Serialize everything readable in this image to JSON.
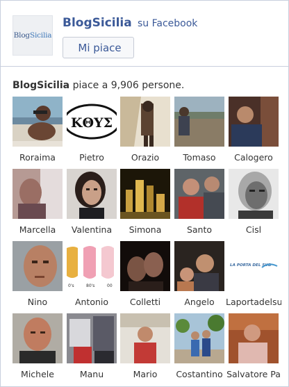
{
  "page": {
    "name": "BlogSicilia",
    "platform_suffix": "su Facebook",
    "logo_text_1": "Blog",
    "logo_text_2": "Sicilia"
  },
  "like_button": {
    "label": "Mi piace"
  },
  "count": {
    "name": "BlogSicilia",
    "text": "piace a 9,906 persone."
  },
  "fans": [
    {
      "name": "Roraima"
    },
    {
      "name": "Pietro"
    },
    {
      "name": "Orazio"
    },
    {
      "name": "Tomaso"
    },
    {
      "name": "Calogero"
    },
    {
      "name": "Marcella"
    },
    {
      "name": "Valentina"
    },
    {
      "name": "Simona"
    },
    {
      "name": "Santo"
    },
    {
      "name": "Cisl"
    },
    {
      "name": "Nino"
    },
    {
      "name": "Antonio"
    },
    {
      "name": "Colletti"
    },
    {
      "name": "Angelo"
    },
    {
      "name": "Laportadelsud"
    },
    {
      "name": "Michele"
    },
    {
      "name": "Manu"
    },
    {
      "name": "Mario"
    },
    {
      "name": "Costantino"
    },
    {
      "name": "Salvatore Pa"
    }
  ],
  "fan_photo_texts": {
    "pietro": "ΚΘΥΣ",
    "antonio_labels": [
      "0's",
      "80's",
      "00"
    ],
    "laportadelsud": "LA PORTA DEL SUD"
  },
  "colors": {
    "brand_blue": "#3b5998",
    "border": "#c8cfdd",
    "text": "#333333"
  }
}
